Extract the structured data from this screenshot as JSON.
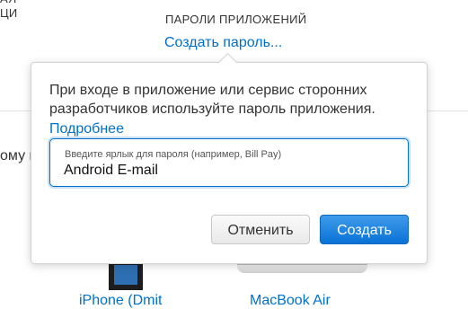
{
  "background": {
    "left_top_text": [
      "АЯ",
      "ЦИ"
    ],
    "section_title": "ПАРОЛИ ПРИЛОЖЕНИЙ",
    "create_link": "Создать пароль...",
    "mid_text": "ому вы",
    "chevron": "›",
    "bottom_left": "iPhone (Dmit",
    "bottom_right": "MacBook Air"
  },
  "popover": {
    "description": "При входе в приложение или сервис сторонних разработчиков используйте пароль приложения.",
    "learn_more": "Подробнее",
    "field": {
      "label": "Введите ярлык для пароля (например, Bill Pay)",
      "value": "Android E-mail"
    },
    "buttons": {
      "cancel": "Отменить",
      "create": "Создать"
    }
  },
  "colors": {
    "accent": "#0070c9",
    "primary_button": "#1a7fdc",
    "text": "#333333"
  }
}
